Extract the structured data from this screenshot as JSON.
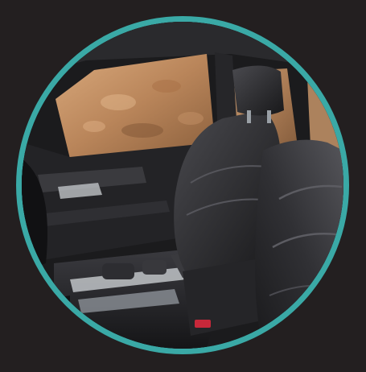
{
  "image": {
    "subject": "car-interior-front-seats",
    "ring_color": "#3aa9a6",
    "background_color": "#231f20",
    "palette": {
      "window": "#b9855a",
      "window_light": "#d9a97c",
      "leather": "#2c2c2f",
      "leather_highlight": "#4a4a4f",
      "trim_chrome": "#bfc3c7",
      "accent_red": "#c8283a"
    }
  }
}
